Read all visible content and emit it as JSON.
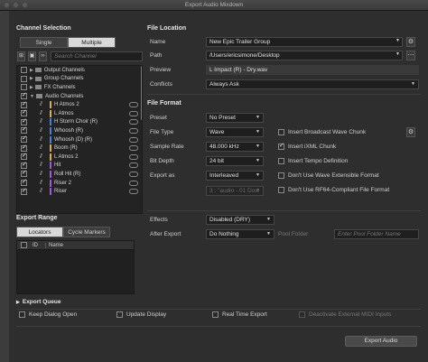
{
  "window_title": "Export Audio Mixdown",
  "channel_selection": {
    "title": "Channel Selection",
    "tabs": [
      "Single",
      "Multiple"
    ],
    "active_tab": "Multiple",
    "search_placeholder": "Search Channel",
    "tree": [
      {
        "label": "Output Channels",
        "kind": "group",
        "checked": false
      },
      {
        "label": "Group Channels",
        "kind": "group",
        "checked": false
      },
      {
        "label": "FX Channels",
        "kind": "group",
        "checked": false
      },
      {
        "label": "Audio Channels",
        "kind": "group-open",
        "checked": true
      },
      {
        "label": "H Atmos 2",
        "kind": "track",
        "checked": true,
        "color": "#d8b04a"
      },
      {
        "label": "L Atmos",
        "kind": "track",
        "checked": true,
        "color": "#d8b04a"
      },
      {
        "label": "H Storm Choir (R)",
        "kind": "track",
        "checked": true,
        "color": "#4a7fd8"
      },
      {
        "label": "Whoosh (R)",
        "kind": "track",
        "checked": true,
        "color": "#4a7fd8"
      },
      {
        "label": "Whoosh (D) (R)",
        "kind": "track",
        "checked": true,
        "color": "#4a7fd8"
      },
      {
        "label": "Boom (R)",
        "kind": "track",
        "checked": true,
        "color": "#d8b04a"
      },
      {
        "label": "L Atmos 2",
        "kind": "track",
        "checked": true,
        "color": "#d8b04a"
      },
      {
        "label": "Hit",
        "kind": "track",
        "checked": true,
        "color": "#a05ad8"
      },
      {
        "label": "Roll Hit (R)",
        "kind": "track",
        "checked": true,
        "color": "#a05ad8"
      },
      {
        "label": "Riser 2",
        "kind": "track",
        "checked": true,
        "color": "#a05ad8"
      },
      {
        "label": "Riser",
        "kind": "track",
        "checked": true,
        "color": "#a05ad8"
      }
    ]
  },
  "export_range": {
    "title": "Export Range",
    "tabs": [
      "Locators",
      "Cycle Markers"
    ],
    "active_tab": "Locators",
    "columns": [
      "ID",
      "Name"
    ]
  },
  "file_location": {
    "title": "File Location",
    "name_label": "Name",
    "name_value": "New Epic Trailer Group",
    "path_label": "Path",
    "path_value": "/Users/ericsimone/Desktop",
    "preview_label": "Preview",
    "preview_value": "L Impact (R) - Dry.wav",
    "conflicts_label": "Conflicts",
    "conflicts_value": "Always Ask"
  },
  "file_format": {
    "title": "File Format",
    "preset_label": "Preset",
    "preset_value": "No Preset",
    "file_type_label": "File Type",
    "file_type_value": "Wave",
    "sample_rate_label": "Sample Rate",
    "sample_rate_value": "48.000 kHz",
    "bit_depth_label": "Bit Depth",
    "bit_depth_value": "24 bit",
    "export_as_label": "Export as",
    "export_as_value": "Interleaved",
    "channel_format_value": "3 : \"audio - 01 Dow",
    "options": [
      {
        "label": "Insert Broadcast Wave Chunk",
        "checked": false
      },
      {
        "label": "Insert iXML Chunk",
        "checked": true
      },
      {
        "label": "Insert Tempo Definition",
        "checked": false
      },
      {
        "label": "Don't Use Wave Extensible Format",
        "checked": false
      },
      {
        "label": "Don't Use RF64-Compliant File Format",
        "checked": false
      }
    ]
  },
  "render": {
    "effects_label": "Effects",
    "effects_value": "Disabled (DRY)",
    "after_export_label": "After Export",
    "after_export_value": "Do Nothing",
    "pool_folder_label": "Pool Folder",
    "pool_folder_placeholder": "Enter Pool Folder Name"
  },
  "export_queue": {
    "title": "Export Queue",
    "options": [
      {
        "label": "Keep Dialog Open",
        "checked": false
      },
      {
        "label": "Update Display",
        "checked": false
      },
      {
        "label": "Real Time Export",
        "checked": false
      },
      {
        "label": "Deactivate External MIDI Inputs",
        "checked": false,
        "disabled": true
      }
    ]
  },
  "export_button": "Export Audio"
}
